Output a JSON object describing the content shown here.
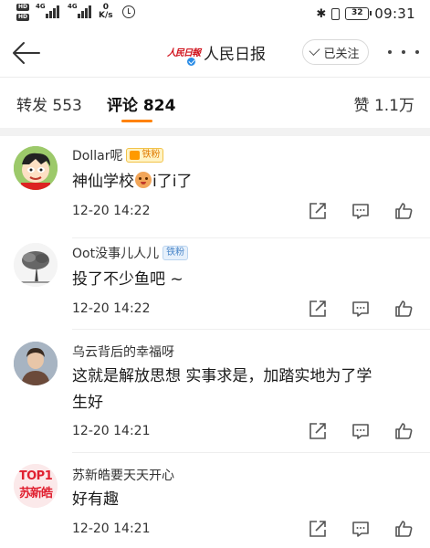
{
  "status_bar": {
    "hd_label": "HD",
    "signal_1": "4G",
    "signal_2": "4G",
    "speed_value": "0",
    "speed_unit": "K/s",
    "battery": "32",
    "time": "09:31"
  },
  "nav": {
    "logo_text": "人民日報",
    "title": "人民日报",
    "follow_label": "已关注"
  },
  "tabs": {
    "repost": "转发 553",
    "comments": "评论 824",
    "likes": "赞 1.1万"
  },
  "colors": {
    "accent_underline": "#ff8200",
    "verified_blue": "#2a8ce6",
    "divider": "#eeeeee"
  },
  "comments": [
    {
      "user": "Dollar呢",
      "badge": "铁粉",
      "text_before": "神仙学校",
      "emoji_icon": "laughing-emoji",
      "text_after": "i了i了",
      "time": "12-20 14:22"
    },
    {
      "user": "Oot没事儿人儿",
      "badge": "铁粉",
      "text": "投了不少鱼吧 ~",
      "time": "12-20 14:22"
    },
    {
      "user": "乌云背后的幸福呀",
      "text": "这就是解放思想 实事求是，加踏实地为了学生好",
      "time": "12-20 14:21"
    },
    {
      "user": "苏新皓要天天开心",
      "avatar_text_top": "TOP1",
      "avatar_text_main": "苏新皓",
      "text": "好有趣",
      "time": "12-20 14:21"
    }
  ]
}
